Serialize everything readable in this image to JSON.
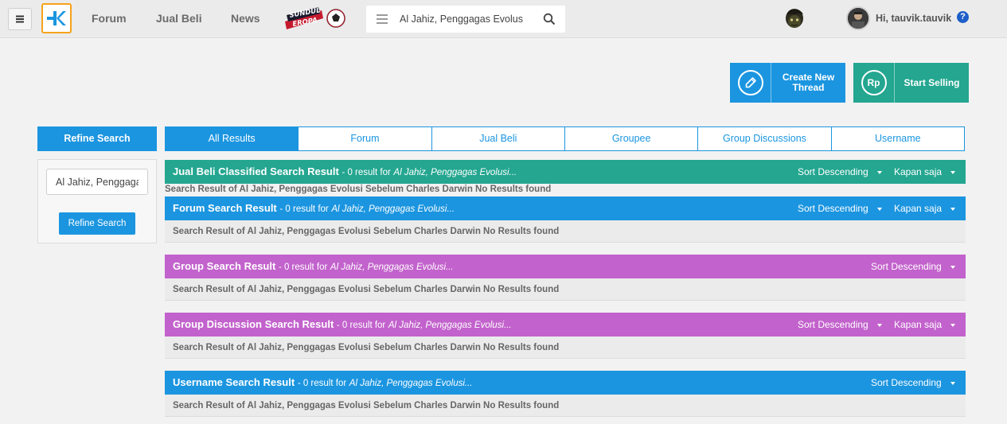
{
  "header": {
    "nav": [
      "Forum",
      "Jual Beli",
      "News"
    ],
    "event_logo_text": [
      "SUNDUL",
      "EROPA"
    ],
    "search_value": "Al Jahiz, Penggagas Evolus",
    "user_greeting": "Hi, tauvik.tauvik",
    "help_label": "?"
  },
  "actions": {
    "create_thread": "Create New Thread",
    "start_selling": "Start Selling",
    "rp_symbol": "Rp"
  },
  "refine": {
    "title": "Refine Search",
    "input_value": "Al Jahiz, Penggagas Evolusi Sebelum Charles Darwin",
    "button": "Refine Search"
  },
  "tabs": [
    {
      "label": "All Results",
      "active": true
    },
    {
      "label": "Forum",
      "active": false
    },
    {
      "label": "Jual Beli",
      "active": false
    },
    {
      "label": "Groupee",
      "active": false
    },
    {
      "label": "Group Discussions",
      "active": false
    },
    {
      "label": "Username",
      "active": false
    }
  ],
  "query_short": "Al Jahiz, Penggagas Evolusi...",
  "count_text": "- 0 result for",
  "sort_label": "Sort Descending",
  "time_label": "Kapan saja",
  "no_results": "Search Result of Al Jahiz, Penggagas Evolusi Sebelum Charles Darwin No Results found",
  "sections": [
    {
      "title": "Jual Beli Classified Search Result",
      "color": "#24a690"
    },
    {
      "title": "Forum Search Result",
      "color": "#1b95e0"
    },
    {
      "title": "Group Search Result",
      "color": "#c262cc"
    },
    {
      "title": "Group Discussion Search Result",
      "color": "#c262cc"
    },
    {
      "title": "Username Search Result",
      "color": "#1b95e0"
    }
  ]
}
